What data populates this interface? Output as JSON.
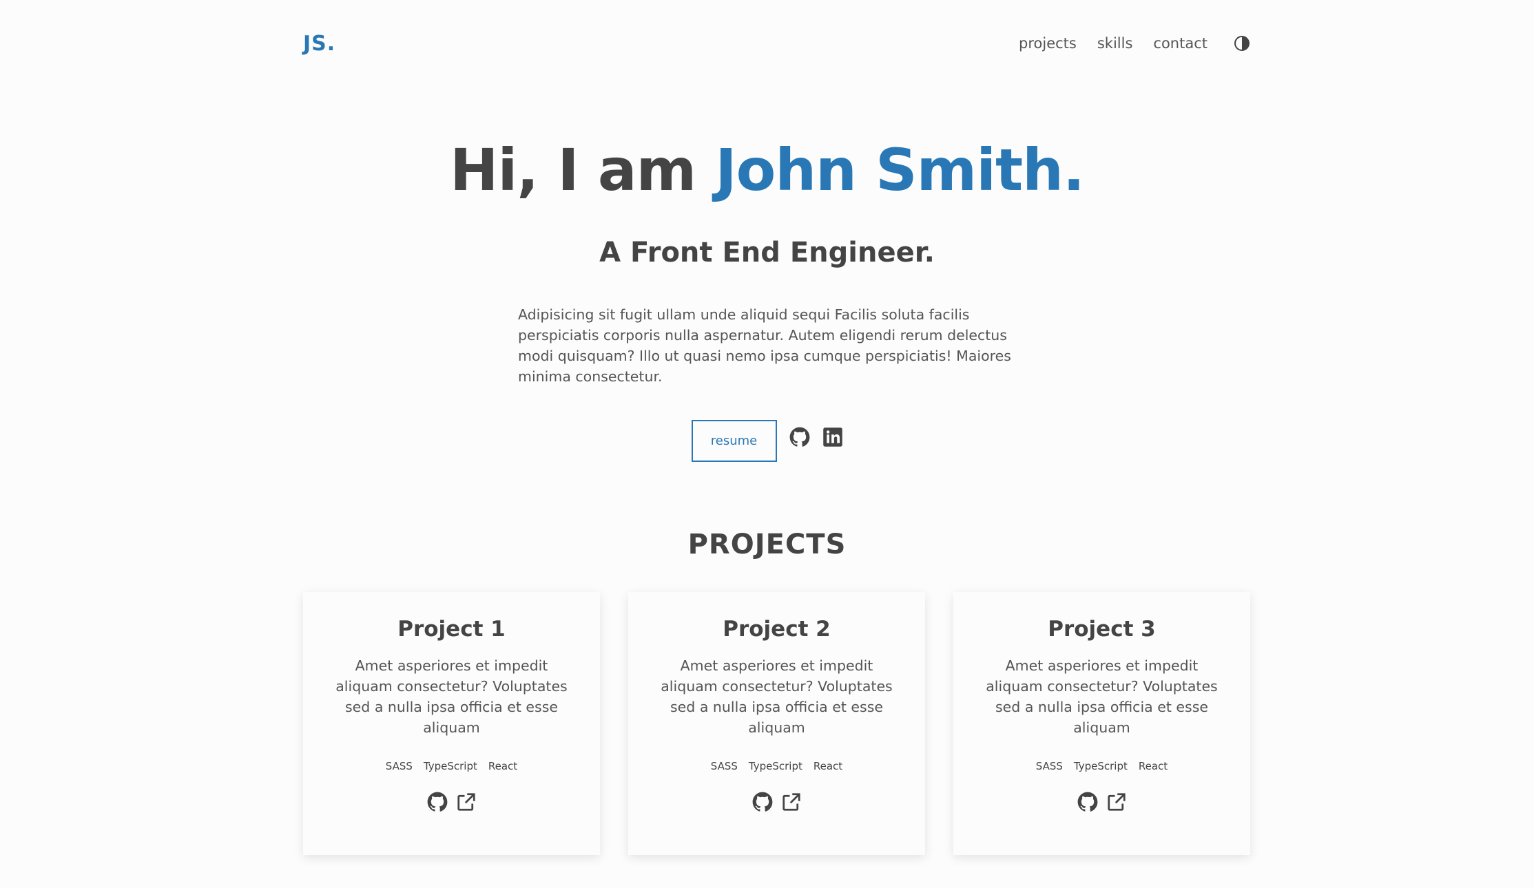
{
  "header": {
    "logo": "JS.",
    "nav": [
      {
        "label": "projects"
      },
      {
        "label": "skills"
      },
      {
        "label": "contact"
      }
    ],
    "theme_icon": "half-moon-icon"
  },
  "hero": {
    "greeting": "Hi, I am",
    "name": "John Smith.",
    "subtitle": "A Front End Engineer.",
    "description": "Adipisicing sit fugit ullam unde aliquid sequi Facilis soluta facilis perspiciatis corporis nulla aspernatur. Autem eligendi rerum delectus modi quisquam? Illo ut quasi nemo ipsa cumque perspiciatis! Maiores minima consectetur.",
    "resume_label": "resume",
    "social_icons": [
      "github-icon",
      "linkedin-icon"
    ]
  },
  "projects": {
    "title": "PROJECTS",
    "items": [
      {
        "title": "Project 1",
        "description": "Amet asperiores et impedit aliquam consectetur? Voluptates sed a nulla ipsa officia et esse aliquam",
        "tags": [
          "SASS",
          "TypeScript",
          "React"
        ]
      },
      {
        "title": "Project 2",
        "description": "Amet asperiores et impedit aliquam consectetur? Voluptates sed a nulla ipsa officia et esse aliquam",
        "tags": [
          "SASS",
          "TypeScript",
          "React"
        ]
      },
      {
        "title": "Project 3",
        "description": "Amet asperiores et impedit aliquam consectetur? Voluptates sed a nulla ipsa officia et esse aliquam",
        "tags": [
          "SASS",
          "TypeScript",
          "React"
        ]
      }
    ]
  },
  "colors": {
    "accent": "#2978b5",
    "text": "#444444",
    "background": "#fcfcfc"
  }
}
